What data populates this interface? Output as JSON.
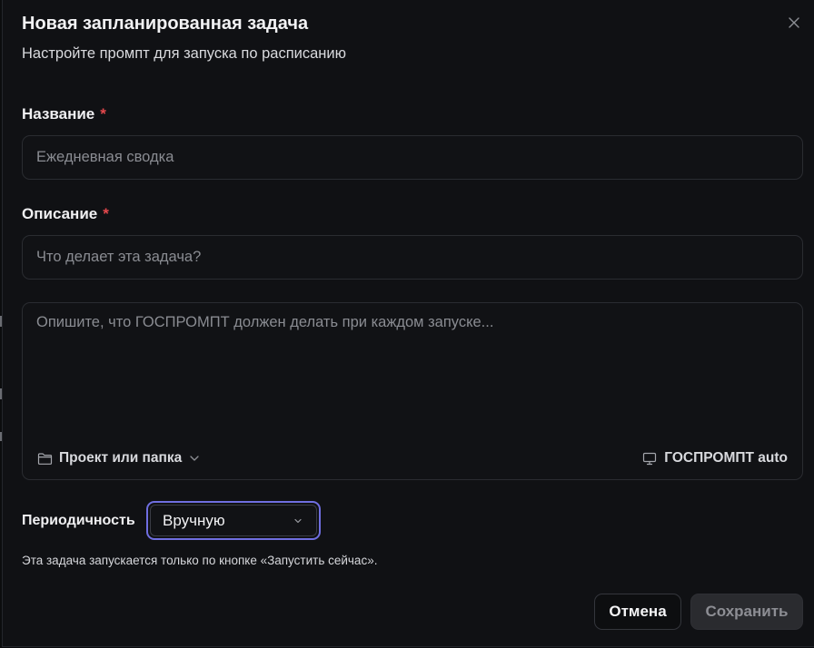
{
  "dialog": {
    "title": "Новая запланированная задача",
    "subtitle": "Настройте промпт для запуска по расписанию",
    "close_icon": "close-icon"
  },
  "form": {
    "name": {
      "label": "Название",
      "required_mark": "*",
      "value": "",
      "placeholder": "Ежедневная сводка"
    },
    "description": {
      "label": "Описание",
      "required_mark": "*",
      "value": "",
      "placeholder": "Что делает эта задача?"
    },
    "prompt": {
      "value": "",
      "placeholder": "Опишите, что ГОСПРОМПТ должен делать при каждом запуске...",
      "project_picker": {
        "icon": "folder-icon",
        "label": "Проект или папка",
        "chevron_icon": "chevron-down-icon"
      },
      "model_picker": {
        "icon": "monitor-icon",
        "label": "ГОСПРОМПТ auto"
      }
    },
    "periodicity": {
      "label": "Периодичность",
      "selected": "Вручную",
      "chevron_icon": "chevron-down-icon"
    },
    "hint": "Эта задача запускается только по кнопке «Запустить сейчас»."
  },
  "actions": {
    "cancel_label": "Отмена",
    "save_label": "Сохранить"
  },
  "colors": {
    "background": "#101114",
    "accent_focus": "#6f6ee0",
    "required": "#e5484d",
    "placeholder": "#8a8c92",
    "disabled_button": "#2a2b2f"
  }
}
